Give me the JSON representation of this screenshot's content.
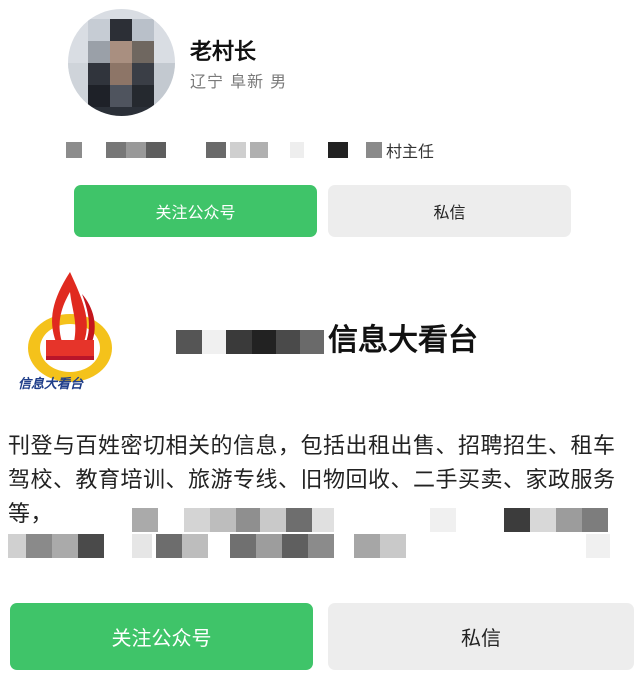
{
  "profile": {
    "name": "老村长",
    "location": "辽宁 阜新 男",
    "role_suffix": "村主任",
    "follow_label": "关注公众号",
    "message_label": "私信"
  },
  "account": {
    "title": "信息大看台",
    "logo_text": "信息大看台",
    "description": "刊登与百姓密切相关的信息，包括出租出售、招聘招生、租车驾校、教育培训、旅游专线、旧物回收、二手买卖、家政服务等，",
    "follow_label": "关注公众号",
    "message_label": "私信"
  },
  "colors": {
    "follow_green": "#3fc469",
    "message_gray": "#ededed"
  },
  "icons": [
    "avatar",
    "flame-logo-icon"
  ]
}
